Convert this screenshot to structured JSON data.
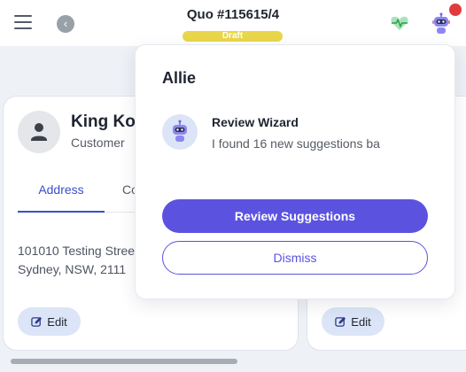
{
  "header": {
    "title": "Quo #115615/4",
    "status_badge": "Draft",
    "icons": {
      "menu": "hamburger-icon",
      "back": "chevron-left-icon",
      "health": "heart-pulse-icon",
      "assistant": "robot-icon"
    },
    "colors": {
      "badge": "#e9d64b",
      "notification": "#e03c3c",
      "health": "#4cbf6e"
    }
  },
  "contact_card": {
    "name": "King Kor",
    "role": "Customer",
    "tabs": [
      {
        "label": "Address"
      },
      {
        "label": "Co"
      }
    ],
    "address_lines": [
      "101010 Testing Stree",
      "Sydney, NSW, 2111"
    ],
    "edit_label": "Edit"
  },
  "second_card": {
    "edit_label": "Edit"
  },
  "popover": {
    "title": "Allie",
    "suggestion_title": "Review Wizard",
    "suggestion_text": "I found 16 new suggestions ba",
    "primary_button": "Review Suggestions",
    "secondary_button": "Dismiss",
    "colors": {
      "primary": "#5b53e0",
      "avatar_bg": "#dbe5f7"
    }
  }
}
